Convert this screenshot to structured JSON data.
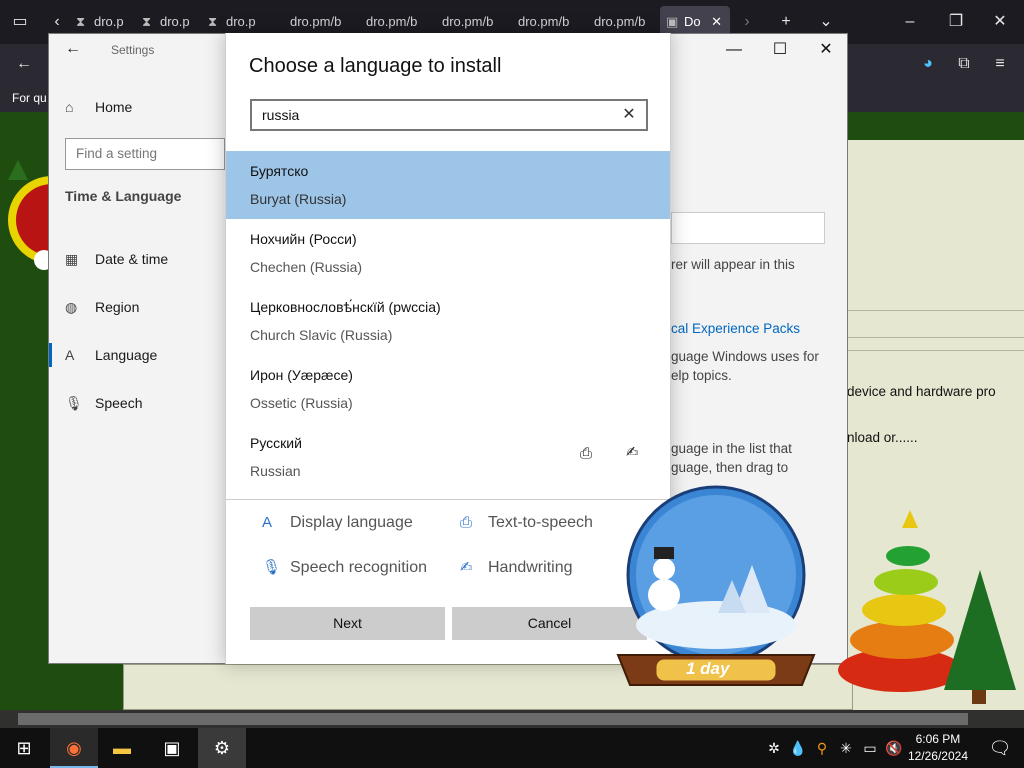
{
  "browser": {
    "tabs": [
      {
        "label": "dro.p"
      },
      {
        "label": "dro.p"
      },
      {
        "label": "dro.p"
      },
      {
        "label": "dro.pm/b"
      },
      {
        "label": "dro.pm/b"
      },
      {
        "label": "dro.pm/b"
      },
      {
        "label": "dro.pm/b"
      },
      {
        "label": "dro.pm/b"
      },
      {
        "label": "Do"
      }
    ],
    "bookmark_text": "For qu"
  },
  "page": {
    "text1": "device and hardware pro",
    "text2": "nload or......"
  },
  "settings": {
    "title": "Settings",
    "home": "Home",
    "find_placeholder": "Find a setting",
    "section": "Time & Language",
    "nav": [
      {
        "label": "Date & time",
        "icon": "calendar-icon"
      },
      {
        "label": "Region",
        "icon": "globe-icon"
      },
      {
        "label": "Language",
        "icon": "language-icon"
      },
      {
        "label": "Speech",
        "icon": "microphone-icon"
      }
    ],
    "right": {
      "line1": "rer will appear in this",
      "link": "cal Experience Packs",
      "line2": "guage Windows uses for",
      "line3": "elp topics.",
      "line4": "guage in the list that",
      "line5": "guage, then drag to"
    }
  },
  "dialog": {
    "title": "Choose a language to install",
    "search_value": "russia",
    "languages": [
      {
        "native": "Бурятско",
        "english": "Buryat (Russia)",
        "selected": true
      },
      {
        "native": "Нохчийн (Росси)",
        "english": "Chechen (Russia)",
        "selected": false
      },
      {
        "native": "Церковнословѣ́нскїй (рwссіа)",
        "english": "Church Slavic (Russia)",
        "selected": false
      },
      {
        "native": "Ирон (Уæрæсе)",
        "english": "Ossetic (Russia)",
        "selected": false
      },
      {
        "native": "Русский",
        "english": "Russian",
        "selected": false
      }
    ],
    "features": {
      "display_language": "Display language",
      "text_to_speech": "Text-to-speech",
      "speech_recognition": "Speech recognition",
      "handwriting": "Handwriting"
    },
    "next_label": "Next",
    "cancel_label": "Cancel"
  },
  "globe": {
    "label": "1 day"
  },
  "taskbar": {
    "time": "6:06 PM",
    "date": "12/26/2024"
  },
  "colors": {
    "selected_row": "#9dc5e8",
    "accent": "#0067c0"
  }
}
